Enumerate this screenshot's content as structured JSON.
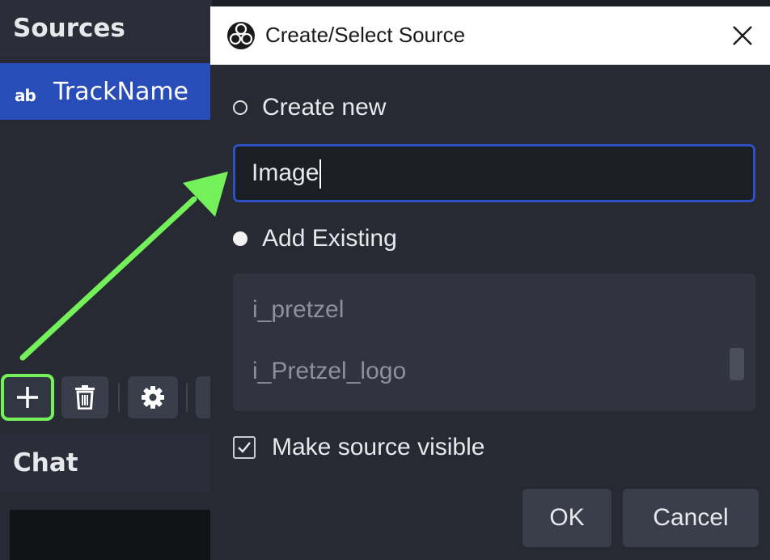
{
  "left_panel": {
    "sources_title": "Sources",
    "source_items": [
      {
        "icon": "text-source-icon",
        "icon_text": "ab",
        "label": "TrackName"
      }
    ],
    "toolbar": {
      "add_icon": "plus-icon",
      "remove_icon": "trash-icon",
      "settings_icon": "gear-icon"
    },
    "chat_title": "Chat"
  },
  "dialog": {
    "title": "Create/Select Source",
    "title_icon": "obs-logo-icon",
    "close_icon": "close-icon",
    "create_new_label": "Create new",
    "create_new_selected": false,
    "name_input_value": "Image",
    "add_existing_label": "Add Existing",
    "add_existing_selected": true,
    "existing_sources": [
      "i_pretzel",
      "i_Pretzel_logo"
    ],
    "make_visible_label": "Make source visible",
    "make_visible_checked": true,
    "ok_label": "OK",
    "cancel_label": "Cancel"
  },
  "annotation": {
    "highlight_color": "#73f05a",
    "arrow_color": "#73f05a"
  },
  "colors": {
    "selection_blue": "#284cb8",
    "input_border": "#2f4fc4",
    "panel_bg": "#272a33"
  }
}
